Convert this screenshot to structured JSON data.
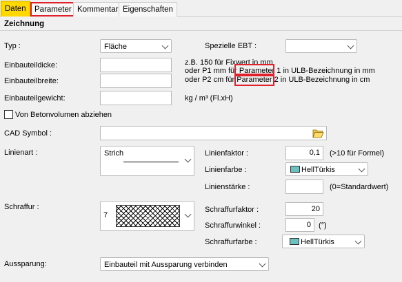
{
  "tabs": [
    {
      "label": "Daten"
    },
    {
      "label": "Parameter"
    },
    {
      "label": "Kommentar"
    },
    {
      "label": "Eigenschaften"
    }
  ],
  "section": {
    "title": "Zeichnung"
  },
  "typ": {
    "label": "Typ :",
    "value": "Fläche"
  },
  "spezielle_ebt": {
    "label": "Spezielle EBT :",
    "value": ""
  },
  "einbauteildicke": {
    "label": "Einbauteildicke:",
    "value": ""
  },
  "einbauteilbreite": {
    "label": "Einbauteilbreite:",
    "value": ""
  },
  "einbauteilgewicht": {
    "label": "Einbauteilgewicht:",
    "value": "",
    "unit": "kg / m³ (Fl.xH)"
  },
  "hint": {
    "line1": "z.B. 150 für Fixwert in mm",
    "line2_pre": "oder P1 mm für ",
    "line2_param": "Parameter",
    "line2_post": " 1 in ULB-Bezeichnung in mm",
    "line3_pre": "oder P2 cm  für ",
    "line3_param": "Parameter",
    "line3_post": " 2 in ULB-Bezeichnung in cm"
  },
  "betonvolumen": {
    "label": "Von Betonvolumen abziehen",
    "checked": false
  },
  "cad_symbol": {
    "label": "CAD Symbol :",
    "value": ""
  },
  "linienart": {
    "label": "Linienart :",
    "value": "Strich"
  },
  "linienfaktor": {
    "label": "Linienfaktor :",
    "value": "0,1",
    "note": "(>10 für Formel)"
  },
  "linienfarbe": {
    "label": "Linienfarbe :",
    "value": "HellTürkis",
    "color": "#6cc0c0"
  },
  "linienstaerke": {
    "label": "Linienstärke :",
    "value": "",
    "note": "(0=Standardwert)"
  },
  "schraffur": {
    "label": "Schraffur :",
    "value": "7"
  },
  "schraffurfaktor": {
    "label": "Schraffurfaktor :",
    "value": "20"
  },
  "schraffurwinkel": {
    "label": "Schraffurwinkel :",
    "value": "0",
    "note": "(°)"
  },
  "schraffurfarbe": {
    "label": "Schraffurfarbe :",
    "value": "HellTürkis",
    "color": "#6cc0c0"
  },
  "aussparung": {
    "label": "Aussparung:",
    "value": "Einbauteil mit Aussparung verbinden"
  }
}
